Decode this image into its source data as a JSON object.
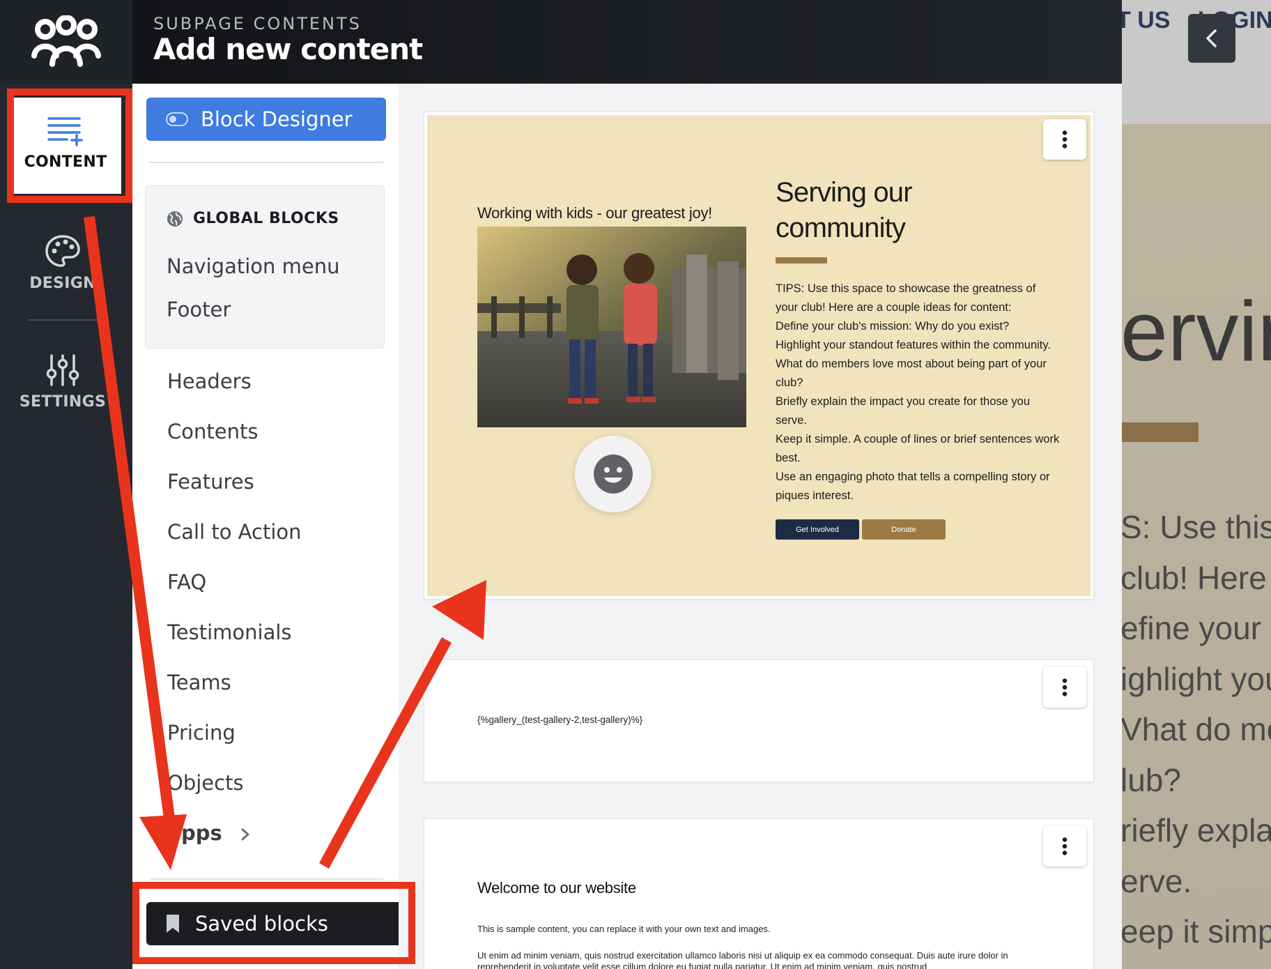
{
  "background_site": {
    "nav_items": [
      "T US",
      "LOGIN"
    ],
    "hero_title": "erving",
    "hero_lines": [
      "S: Use this s",
      " club! Here",
      "efine your",
      "ighlight you",
      "Vhat do men",
      "lub?",
      "riefly explai",
      "erve.",
      "eep it simpl"
    ]
  },
  "header": {
    "subtitle": "SUBPAGE CONTENTS",
    "title": "Add new content"
  },
  "rail": {
    "content_label": "CONTENT",
    "design_label": "DESIGN",
    "settings_label": "SETTINGS"
  },
  "panel": {
    "block_designer_label": "Block Designer",
    "global_blocks_heading": "GLOBAL BLOCKS",
    "global_items": [
      "Navigation menu",
      "Footer"
    ],
    "categories": [
      "Headers",
      "Contents",
      "Features",
      "Call to Action",
      "FAQ",
      "Testimonials",
      "Teams",
      "Pricing",
      "Objects"
    ],
    "apps_label": "pps",
    "saved_blocks_label": "Saved blocks"
  },
  "canvas": {
    "block1": {
      "caption": "Working with kids - our greatest joy!",
      "title_line1": "Serving our",
      "title_line2": "community",
      "body_lines": [
        "TIPS: Use this space to showcase the greatness of",
        "your club! Here are a couple ideas for content:",
        "Define your club's mission: Why do you exist?",
        "Highlight your standout features within the community.",
        "What do members love most about being part of your",
        "club?",
        "Briefly explain the impact you create for those you",
        "serve.",
        "Keep it simple. A couple of lines or brief sentences work",
        "best.",
        "Use an engaging photo that tells a compelling story or",
        "piques interest."
      ],
      "button_primary": "Get Involved",
      "button_secondary": "Donate"
    },
    "block2": {
      "code": "{%gallery_(test-gallery-2,test-gallery)%}"
    },
    "block3": {
      "title": "Welcome to our website",
      "paragraph1": "This is sample content, you can replace it with your own text and images.",
      "paragraph2": "Ut enim ad minim veniam, quis nostrud exercitation ullamco laboris nisi ut aliquip ex ea commodo consequat. Duis aute irure dolor in reprehenderit in voluptate velit esse cillum dolore eu fugiat nulla pariatur. Ut enim ad minim veniam, quis nostrud"
    }
  },
  "colors": {
    "accent_blue": "#3f7be0",
    "annotation_red": "#e8341c",
    "block_background": "#f1e3bc",
    "button_dark": "#1e2b45",
    "button_gold": "#9d7a43"
  },
  "icons": [
    "people-logo-icon",
    "content-add-icon",
    "palette-icon",
    "sliders-icon",
    "chevron-left-icon",
    "toggle-icon",
    "globe-icon",
    "chevron-right-icon",
    "bookmark-icon",
    "more-vertical-icon",
    "smiley-icon"
  ]
}
